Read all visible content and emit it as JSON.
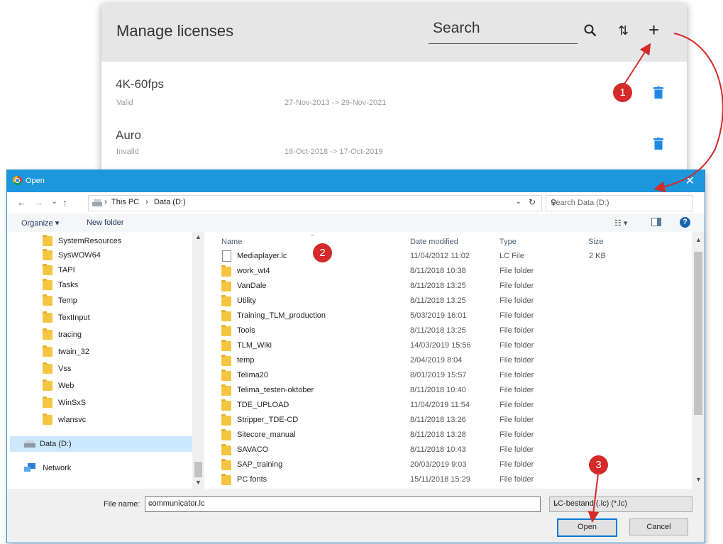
{
  "license_manager": {
    "title": "Manage licenses",
    "search_placeholder": "Search",
    "icons": {
      "search": "🔍",
      "sort": "⇅",
      "add": "+"
    },
    "licenses": [
      {
        "name": "4K-60fps",
        "status": "Valid",
        "range": "27-Nov-2013 -> 29-Nov-2021"
      },
      {
        "name": "Auro",
        "status": "Invalid",
        "range": "16-Oct-2018 -> 17-Oct-2019"
      }
    ]
  },
  "dialog": {
    "title": "Open",
    "close": "✕",
    "nav": {
      "back": "←",
      "forward": "→",
      "recent": "⌄",
      "up": "↑"
    },
    "breadcrumb": [
      "This PC",
      "Data (D:)"
    ],
    "search_placeholder": "Search Data (D:)",
    "toolbar": {
      "organize": "Organize ▾",
      "new_folder": "New folder",
      "help": "?"
    },
    "tree": [
      {
        "label": "SystemResources"
      },
      {
        "label": "SysWOW64"
      },
      {
        "label": "TAPI"
      },
      {
        "label": "Tasks"
      },
      {
        "label": "Temp"
      },
      {
        "label": "TextInput"
      },
      {
        "label": "tracing"
      },
      {
        "label": "twain_32"
      },
      {
        "label": "Vss"
      },
      {
        "label": "Web"
      },
      {
        "label": "WinSxS"
      },
      {
        "label": "wlansvc"
      },
      {
        "label": "Data (D:)"
      },
      {
        "label": "Network"
      }
    ],
    "columns": {
      "name": "Name",
      "date": "Date modified",
      "type": "Type",
      "size": "Size"
    },
    "files": [
      {
        "name": "Mediaplayer.lc",
        "date": "11/04/2012 11:02",
        "type": "LC File",
        "size": "2 KB"
      },
      {
        "name": "work_wt4",
        "date": "8/11/2018 10:38",
        "type": "File folder",
        "size": ""
      },
      {
        "name": "VanDale",
        "date": "8/11/2018 13:25",
        "type": "File folder",
        "size": ""
      },
      {
        "name": "Utility",
        "date": "8/11/2018 13:25",
        "type": "File folder",
        "size": ""
      },
      {
        "name": "Training_TLM_production",
        "date": "5/03/2019 16:01",
        "type": "File folder",
        "size": ""
      },
      {
        "name": "Tools",
        "date": "8/11/2018 13:25",
        "type": "File folder",
        "size": ""
      },
      {
        "name": "TLM_Wiki",
        "date": "14/03/2019 15:56",
        "type": "File folder",
        "size": ""
      },
      {
        "name": "temp",
        "date": "2/04/2019 8:04",
        "type": "File folder",
        "size": ""
      },
      {
        "name": "Telima20",
        "date": "8/01/2019 15:57",
        "type": "File folder",
        "size": ""
      },
      {
        "name": "Telima_testen-oktober",
        "date": "8/11/2018 10:40",
        "type": "File folder",
        "size": ""
      },
      {
        "name": "TDE_UPLOAD",
        "date": "11/04/2019 11:54",
        "type": "File folder",
        "size": ""
      },
      {
        "name": "Stripper_TDE-CD",
        "date": "8/11/2018 13:26",
        "type": "File folder",
        "size": ""
      },
      {
        "name": "Sitecore_manual",
        "date": "8/11/2018 13:28",
        "type": "File folder",
        "size": ""
      },
      {
        "name": "SAVACO",
        "date": "8/11/2018 10:43",
        "type": "File folder",
        "size": ""
      },
      {
        "name": "SAP_training",
        "date": "20/03/2019 9:03",
        "type": "File folder",
        "size": ""
      },
      {
        "name": "PC fonts",
        "date": "15/11/2018 15:29",
        "type": "File folder",
        "size": ""
      }
    ],
    "file_name_label": "File name:",
    "file_name_value": "communicator.lc",
    "file_type": "LC-bestand (.lc) (*.lc)",
    "open_button": "Open",
    "cancel_button": "Cancel"
  },
  "annotations": {
    "step1": "1",
    "step2": "2",
    "step3": "3",
    "color": "#d42a2a"
  }
}
